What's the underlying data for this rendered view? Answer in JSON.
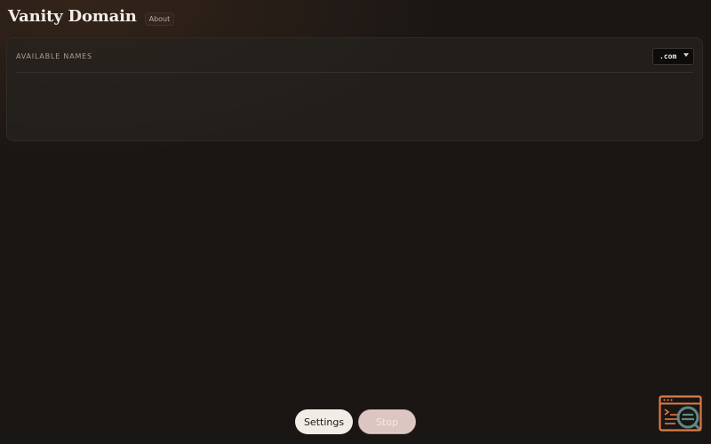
{
  "header": {
    "title": "Vanity Domain",
    "about_label": "About"
  },
  "panel": {
    "label": "AVAILABLE NAMES",
    "tld_selected": ".com",
    "names": []
  },
  "controls": {
    "settings_label": "Settings",
    "stop_label": "Stop"
  },
  "fab": {
    "icon": "terminal-window-search-icon"
  },
  "colors": {
    "background": "#1a1614",
    "panel": "#26221f",
    "fab_orange": "#e07a47",
    "fab_teal": "#5f8a86",
    "settings_button": "#f1ece6",
    "stop_button": "#ddc6c2"
  }
}
